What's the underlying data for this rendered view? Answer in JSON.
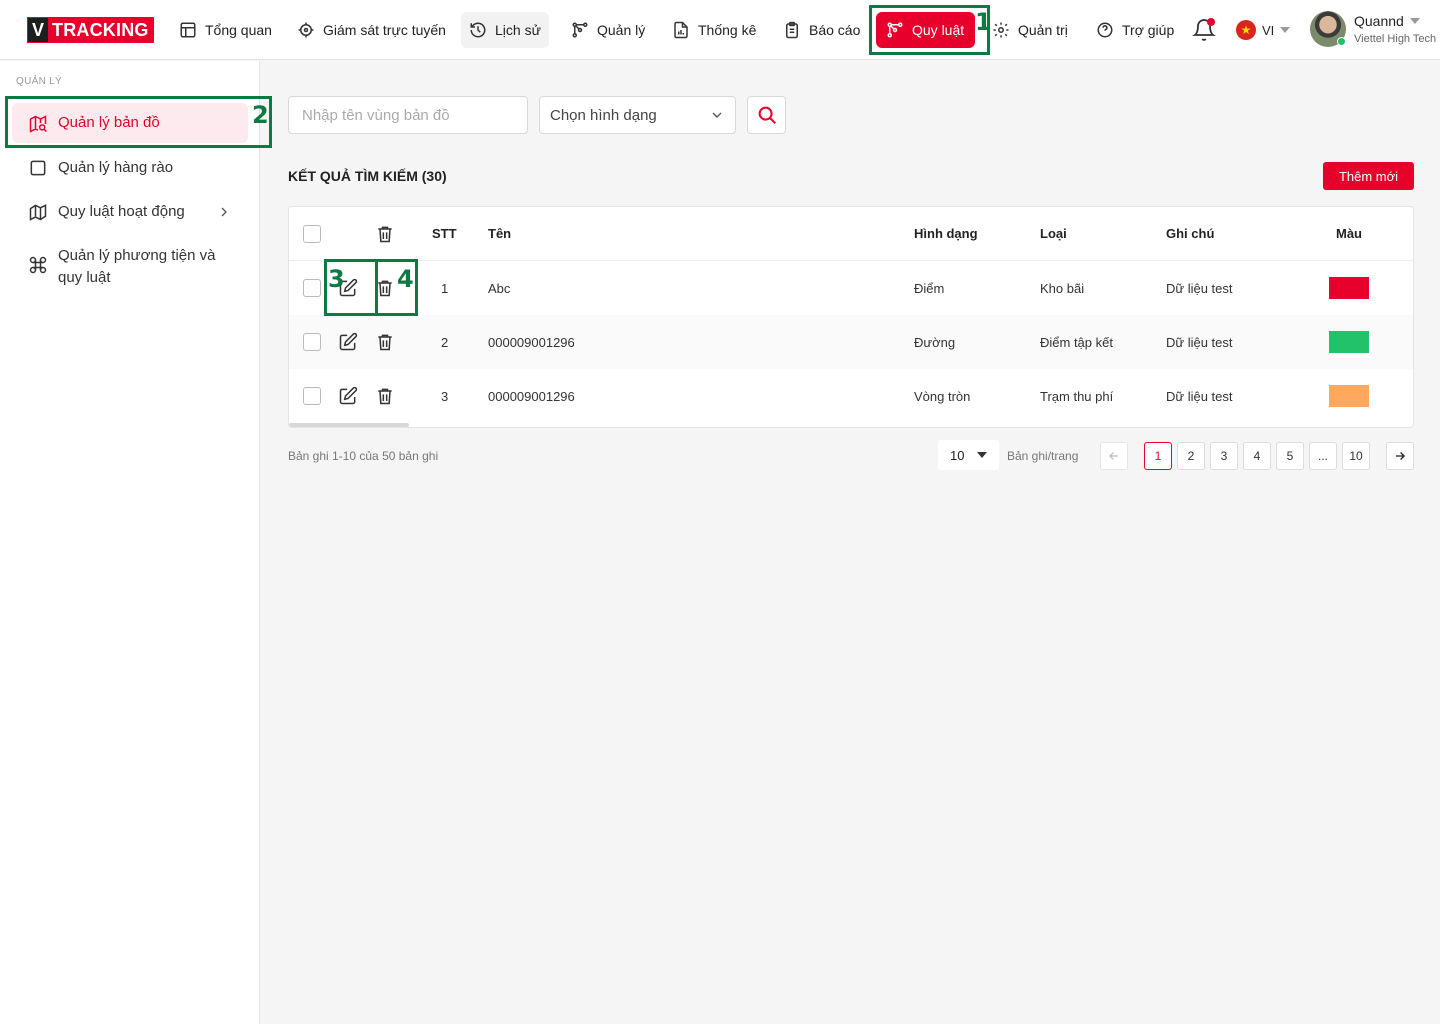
{
  "brand": {
    "logo_v": "V",
    "logo_text": "TRACKING"
  },
  "nav": [
    {
      "label": "Tổng quan",
      "icon": "dashboard-icon"
    },
    {
      "label": "Giám sát trực tuyến",
      "icon": "target-icon"
    },
    {
      "label": "Lịch sử",
      "icon": "history-icon"
    },
    {
      "label": "Quản lý",
      "icon": "network-icon"
    },
    {
      "label": "Thống kê",
      "icon": "chart-file-icon"
    },
    {
      "label": "Báo cáo",
      "icon": "clipboard-icon"
    },
    {
      "label": "Quy luật",
      "icon": "rules-icon"
    },
    {
      "label": "Quản trị",
      "icon": "gear-icon"
    },
    {
      "label": "Trợ giúp",
      "icon": "help-icon"
    }
  ],
  "lang": {
    "code": "VI"
  },
  "user": {
    "name": "Quannd",
    "org": "Viettel High Tech"
  },
  "sidebar": {
    "section": "QUẢN LÝ",
    "items": [
      {
        "label": "Quản lý bản đồ",
        "icon": "map-icon"
      },
      {
        "label": "Quản lý hàng rào",
        "icon": "square-icon"
      },
      {
        "label": "Quy luật hoạt động",
        "icon": "map-fold-icon"
      },
      {
        "label": "Quản lý phương tiện và quy luật",
        "icon": "command-icon"
      }
    ]
  },
  "filters": {
    "name_placeholder": "Nhập tên vùng bản đồ",
    "shape_placeholder": "Chọn hình dạng"
  },
  "results": {
    "title": "KẾT QUẢ TÌM KIẾM (30)",
    "add_label": "Thêm mới"
  },
  "table": {
    "headers": {
      "stt": "STT",
      "name": "Tên",
      "shape": "Hình dạng",
      "type": "Loại",
      "note": "Ghi chú",
      "color": "Màu"
    },
    "rows": [
      {
        "stt": "1",
        "name": "Abc",
        "shape": "Điểm",
        "type": "Kho bãi",
        "note": "Dữ liệu test",
        "color": "#e8002d"
      },
      {
        "stt": "2",
        "name": "000009001296",
        "shape": "Đường",
        "type": "Điểm tập kết",
        "note": "Dữ liệu test",
        "color": "#22c26a"
      },
      {
        "stt": "3",
        "name": "000009001296",
        "shape": "Vòng tròn",
        "type": "Trạm thu phí",
        "note": "Dữ liệu test",
        "color": "#ffa95e"
      }
    ]
  },
  "pagination": {
    "info": "Bản ghi 1-10 của 50 bản ghi",
    "page_size": "10",
    "page_size_label": "Bản ghi/trang",
    "pages": [
      "1",
      "2",
      "3",
      "4",
      "5",
      "...",
      "10"
    ]
  },
  "annotations": [
    "1",
    "2",
    "3",
    "4"
  ],
  "colors": {
    "accent": "#e8002d",
    "annotation": "#0c7a43"
  }
}
